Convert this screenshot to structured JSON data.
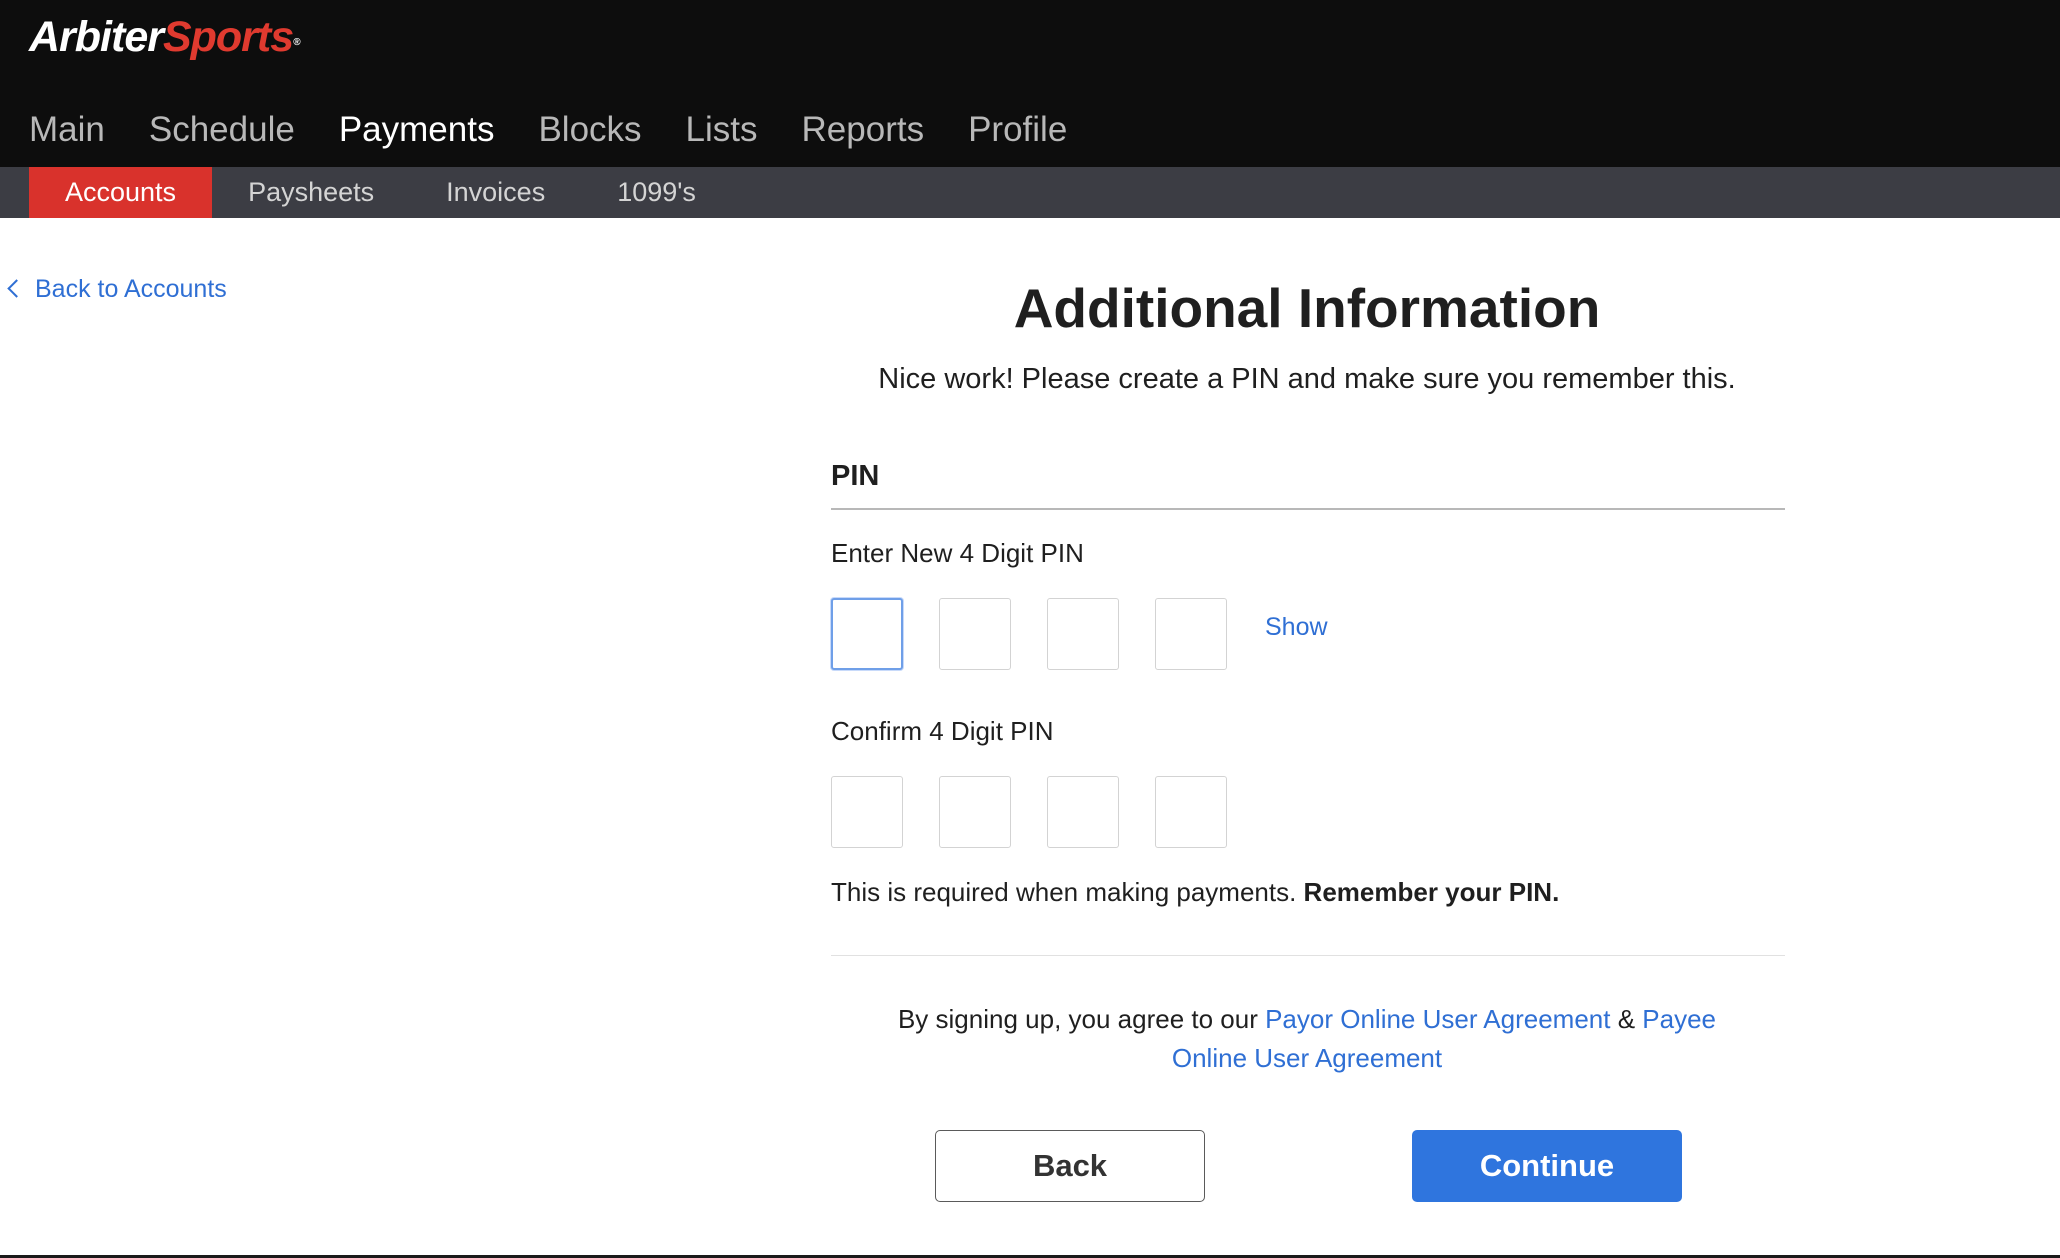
{
  "brand": {
    "logo_white": "Arbiter",
    "logo_red": "Sports",
    "logo_mark": "®"
  },
  "main_nav": [
    {
      "label": "Main",
      "active": false
    },
    {
      "label": "Schedule",
      "active": false
    },
    {
      "label": "Payments",
      "active": true
    },
    {
      "label": "Blocks",
      "active": false
    },
    {
      "label": "Lists",
      "active": false
    },
    {
      "label": "Reports",
      "active": false
    },
    {
      "label": "Profile",
      "active": false
    }
  ],
  "sub_nav": [
    {
      "label": "Accounts",
      "active": true
    },
    {
      "label": "Paysheets",
      "active": false
    },
    {
      "label": "Invoices",
      "active": false
    },
    {
      "label": "1099's",
      "active": false
    }
  ],
  "back_link": "Back to Accounts",
  "form": {
    "title": "Additional Information",
    "subtitle": "Nice work! Please create a PIN and make sure you remember this.",
    "section": "PIN",
    "new_pin_label": "Enter New 4 Digit PIN",
    "confirm_pin_label": "Confirm 4 Digit PIN",
    "show_label": "Show",
    "note_text": "This is required when making payments. ",
    "note_bold": "Remember your PIN.",
    "agree_prefix": "By signing up, you agree to our ",
    "agree_link1": "Payor Online User Agreement",
    "agree_amp": " & ",
    "agree_link2": "Payee Online User Agreement",
    "back_button": "Back",
    "continue_button": "Continue"
  },
  "colors": {
    "accent": "#2f75de",
    "brand_red": "#d9322c",
    "header_bg": "#0d0d0d",
    "subnav_bg": "#3c3d44"
  }
}
